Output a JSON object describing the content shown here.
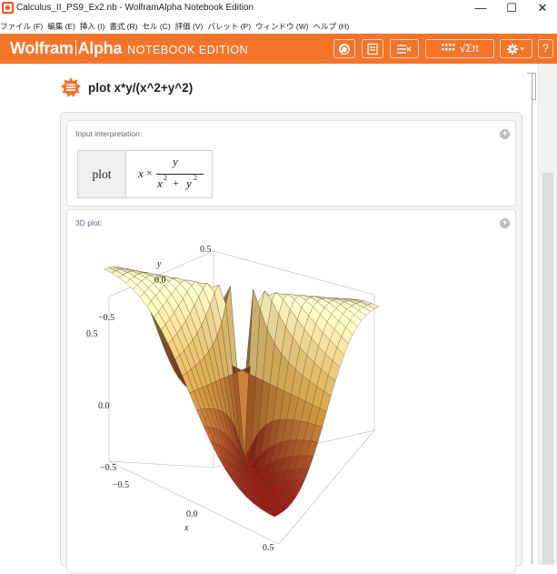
{
  "window": {
    "title": "Calculus_II_PS9_Ex2.nb - WolframAlpha Notebook Edition",
    "controls": [
      "—",
      "☐",
      "✕"
    ]
  },
  "menu": [
    "ファイル (F)",
    "編集 (E)",
    "挿入 (I)",
    "書式 (R)",
    "セル (C)",
    "評価 (V)",
    "パレット (P)",
    "ウィンドウ (W)",
    "ヘルプ (H)"
  ],
  "toolbar": {
    "brand_main": "Wolfram",
    "brand_alpha": "Alpha",
    "brand_edition": "NOTEBOOK EDITION",
    "math_label": "√Σπ"
  },
  "query": {
    "text": "plot x*y/(x^2+y^2)"
  },
  "pods": {
    "interpretation": {
      "title": "Input interpretation:",
      "cell_label": "plot",
      "expr_x": "x",
      "expr_times": "×",
      "numerator": "y",
      "denominator_a": "x",
      "denominator_plus": "+",
      "denominator_b": "y",
      "exp": "2"
    },
    "plot": {
      "title": "3D plot:",
      "axis_y_label": "y",
      "axis_x_label": "x",
      "ticks": {
        "back_top": "0.5",
        "y_mid": "0.0",
        "y_neg": "−0.5",
        "z_top": "0.5",
        "z_mid": "0.0",
        "z_bot": "−0.5",
        "x_neg": "−0.5",
        "x_mid": "0.0",
        "x_pos": "0.5"
      }
    }
  },
  "chart_data": {
    "type": "surface3d",
    "function": "x*y/(x^2+y^2)",
    "x_range": [
      -0.5,
      0.5
    ],
    "y_range": [
      -0.5,
      0.5
    ],
    "z_range": [
      -0.5,
      0.5
    ],
    "xlabel": "x",
    "ylabel": "y",
    "colors": {
      "high": "#fbf7c8",
      "mid": "#e9b04a",
      "low": "#a41a14"
    }
  }
}
